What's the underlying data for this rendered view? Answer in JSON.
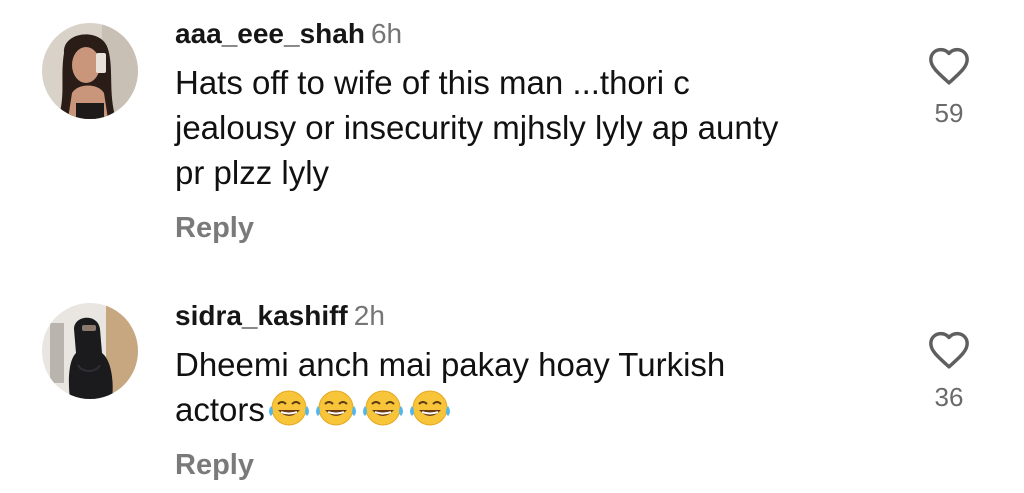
{
  "comments": [
    {
      "username": "aaa_eee_shah",
      "time": "6h",
      "text": "Hats off to wife of this man ...thori c jealousy or insecurity mjhsly lyly ap aunty pr plzz lyly",
      "reply_label": "Reply",
      "likes": "59",
      "avatar": "woman-selfie-avatar"
    },
    {
      "username": "sidra_kashiff",
      "time": "2h",
      "text": "Dheemi anch mai pakay hoay Turkish actors",
      "emoji": "😂😂😂😂",
      "emoji_name": "face-with-tears-of-joy",
      "reply_label": "Reply",
      "likes": "36",
      "avatar": "hijab-woman-avatar"
    }
  ],
  "icons": {
    "like": "heart-outline-icon"
  },
  "colors": {
    "username": "#161616",
    "timestamp": "#757575",
    "reply": "#7a7a7a",
    "like_count": "#6a6a6a",
    "emoji_face": "#f8c43a"
  }
}
